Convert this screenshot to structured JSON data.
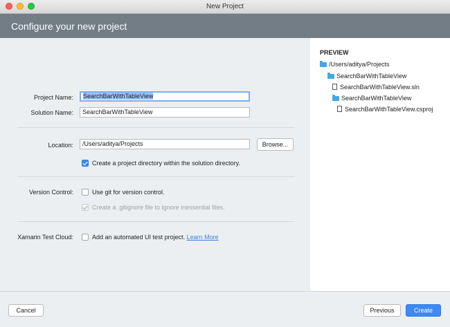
{
  "window": {
    "title": "New Project"
  },
  "header": {
    "title": "Configure your new project"
  },
  "form": {
    "project_name_label": "Project Name:",
    "project_name_value": "SearchBarWithTableView",
    "solution_name_label": "Solution Name:",
    "solution_name_value": "SearchBarWithTableView",
    "location_label": "Location:",
    "location_value": "/Users/aditya/Projects",
    "browse_label": "Browse...",
    "create_dir_label": "Create a project directory within the solution directory.",
    "create_dir_checked": true,
    "version_control_label": "Version Control:",
    "use_git_label": "Use git for version control.",
    "use_git_checked": false,
    "gitignore_label": "Create a .gitignore file to ignore inessential files.",
    "gitignore_checked": true,
    "test_cloud_label": "Xamarin Test Cloud:",
    "ui_test_label": "Add an automated UI test project.",
    "ui_test_checked": false,
    "learn_more_label": "Learn More"
  },
  "preview": {
    "title": "PREVIEW",
    "tree": [
      {
        "icon": "folder-icon",
        "label": "/Users/aditya/Projects"
      },
      {
        "icon": "folder-icon",
        "label": "SearchBarWithTableView"
      },
      {
        "icon": "file-icon",
        "label": "SearchBarWithTableView.sln"
      },
      {
        "icon": "folder-icon",
        "label": "SearchBarWithTableView"
      },
      {
        "icon": "file-icon",
        "label": "SearchBarWithTableView.csproj"
      }
    ]
  },
  "footer": {
    "cancel_label": "Cancel",
    "previous_label": "Previous",
    "create_label": "Create"
  },
  "colors": {
    "header_bg": "#727d86",
    "accent": "#3c8af5",
    "folder": "#3fa9e6",
    "link": "#3f7fe0"
  }
}
